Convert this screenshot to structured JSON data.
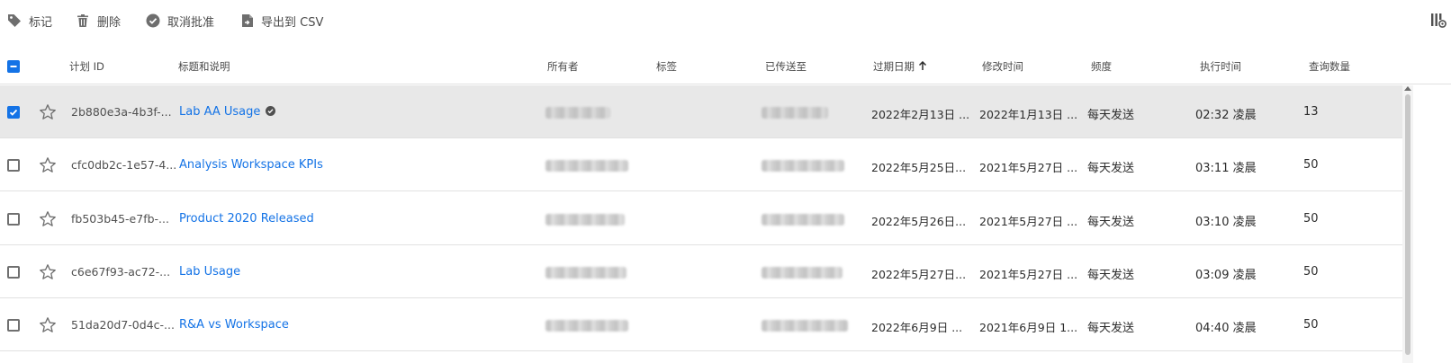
{
  "toolbar": {
    "tag_label": "标记",
    "delete_label": "删除",
    "unapprove_label": "取消批准",
    "export_label": "导出到 CSV"
  },
  "columns": {
    "id": "计划 ID",
    "title": "标题和说明",
    "owner": "所有者",
    "tags": "标签",
    "sent_to": "已传送至",
    "expires": "过期日期",
    "modified": "修改时间",
    "frequency": "频度",
    "run_time": "执行时间",
    "queries": "查询数量"
  },
  "colors": {
    "accent": "#1473e6",
    "selected_row": "#e8e8e8"
  },
  "rows": [
    {
      "selected": true,
      "id": "2b880e3a-4b3f-...",
      "title": "Lab AA Usage",
      "approved": true,
      "expires": "2022年2月13日 ...",
      "modified": "2022年1月13日 ...",
      "frequency": "每天发送",
      "run_time": "02:32 凌晨",
      "queries": "13"
    },
    {
      "selected": false,
      "id": "cfc0db2c-1e57-4...",
      "title": "Analysis Workspace KPIs",
      "approved": false,
      "expires": "2022年5月25日...",
      "modified": "2021年5月27日 ...",
      "frequency": "每天发送",
      "run_time": "03:11 凌晨",
      "queries": "50"
    },
    {
      "selected": false,
      "id": "fb503b45-e7fb-...",
      "title": "Product 2020 Released",
      "approved": false,
      "expires": "2022年5月26日...",
      "modified": "2021年5月27日 ...",
      "frequency": "每天发送",
      "run_time": "03:10 凌晨",
      "queries": "50"
    },
    {
      "selected": false,
      "id": "c6e67f93-ac72-...",
      "title": "Lab Usage",
      "approved": false,
      "expires": "2022年5月27日...",
      "modified": "2021年5月27日 ...",
      "frequency": "每天发送",
      "run_time": "03:09 凌晨",
      "queries": "50"
    },
    {
      "selected": false,
      "id": "51da20d7-0d4c-...",
      "title": "R&A vs Workspace",
      "approved": false,
      "expires": "2022年6月9日 ...",
      "modified": "2021年6月9日 1...",
      "frequency": "每天发送",
      "run_time": "04:40 凌晨",
      "queries": "50"
    }
  ]
}
